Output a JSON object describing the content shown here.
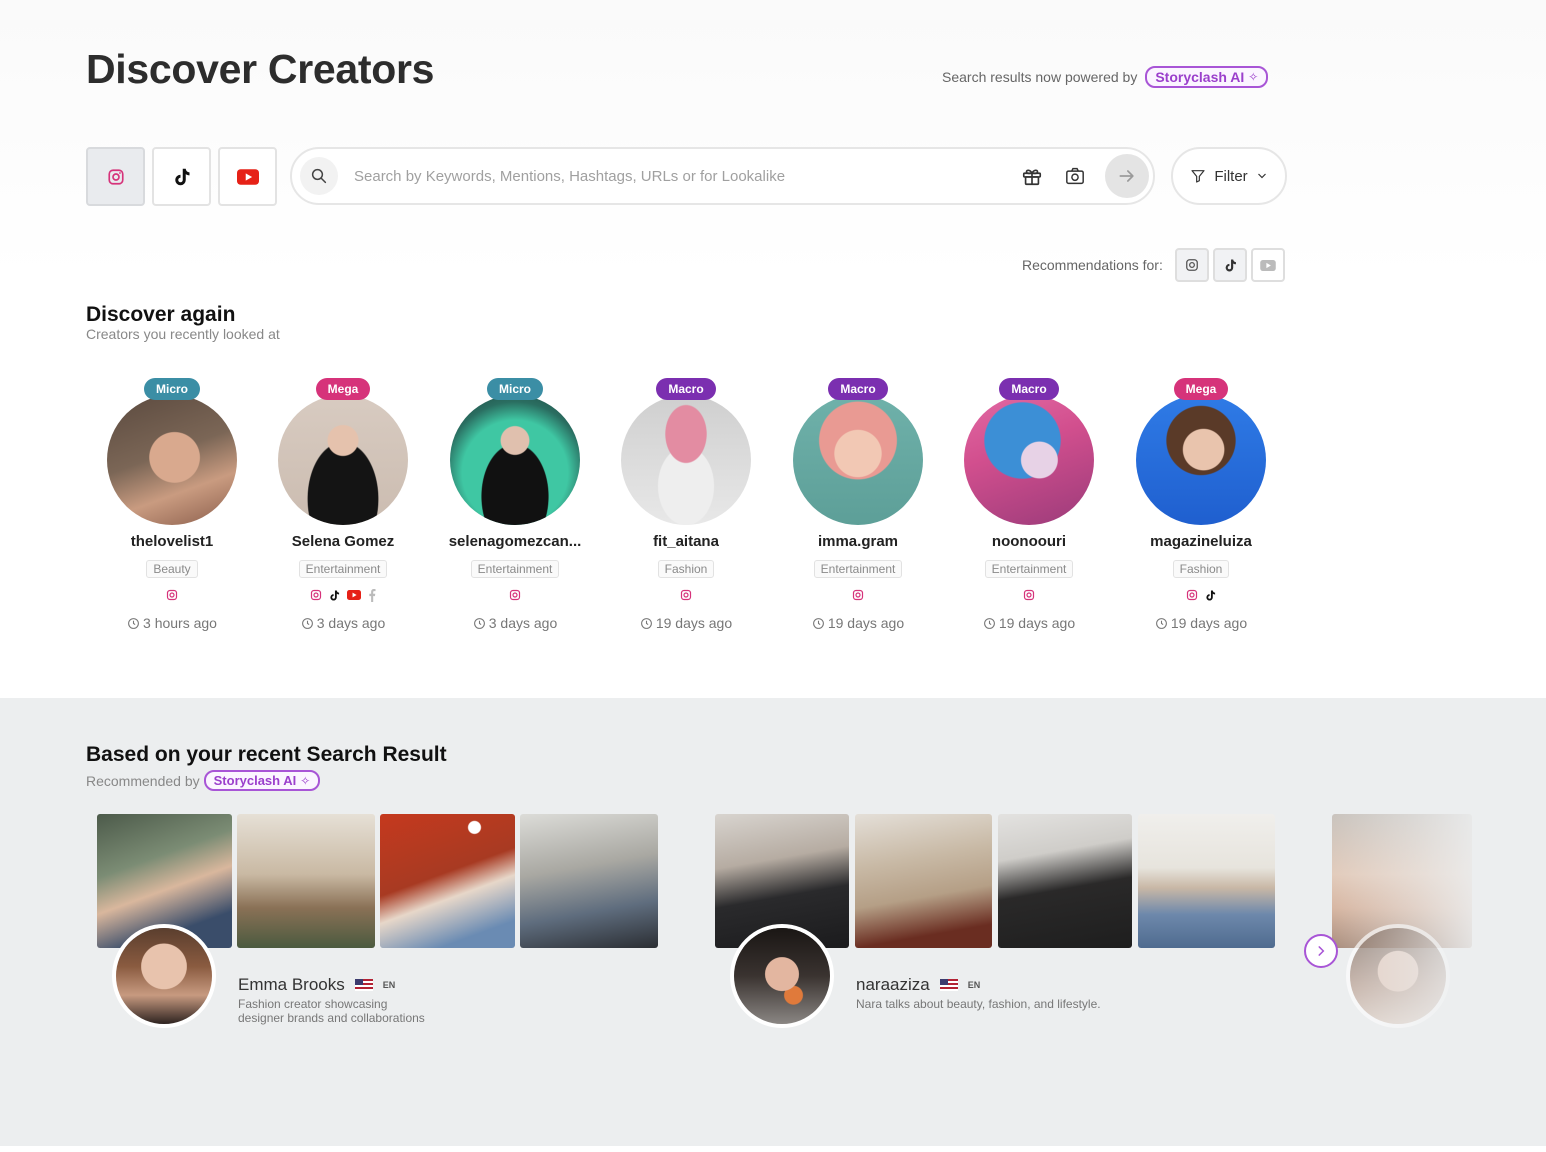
{
  "page": {
    "title": "Discover Creators"
  },
  "powered": {
    "text": "Search results now powered by",
    "badge": "Storyclash AI"
  },
  "platforms": [
    "instagram-icon",
    "tiktok-icon",
    "youtube-icon"
  ],
  "search": {
    "placeholder": "Search by Keywords, Mentions, Hashtags, URLs or for Lookalike",
    "value": ""
  },
  "filter": {
    "label": "Filter"
  },
  "recommendations": {
    "label": "Recommendations for:"
  },
  "discover_again": {
    "title": "Discover again",
    "subtitle": "Creators you recently looked at",
    "creators": [
      {
        "tier": "Micro",
        "name": "thelovelist1",
        "category": "Beauty",
        "platforms": [
          "instagram"
        ],
        "time": "3 hours ago"
      },
      {
        "tier": "Mega",
        "name": "Selena Gomez",
        "category": "Entertainment",
        "platforms": [
          "instagram",
          "tiktok",
          "youtube",
          "facebook"
        ],
        "time": "3 days ago"
      },
      {
        "tier": "Micro",
        "name": "selenagomezcan...",
        "category": "Entertainment",
        "platforms": [
          "instagram"
        ],
        "time": "3 days ago"
      },
      {
        "tier": "Macro",
        "name": "fit_aitana",
        "category": "Fashion",
        "platforms": [
          "instagram"
        ],
        "time": "19 days ago"
      },
      {
        "tier": "Macro",
        "name": "imma.gram",
        "category": "Entertainment",
        "platforms": [
          "instagram"
        ],
        "time": "19 days ago"
      },
      {
        "tier": "Macro",
        "name": "noonoouri",
        "category": "Entertainment",
        "platforms": [
          "instagram"
        ],
        "time": "19 days ago"
      },
      {
        "tier": "Mega",
        "name": "magazineluiza",
        "category": "Fashion",
        "platforms": [
          "instagram",
          "tiktok"
        ],
        "time": "19 days ago"
      }
    ]
  },
  "tier_colors": {
    "Micro": "#3b8ea5",
    "Mega": "#d6337a",
    "Macro": "#7b2fb0"
  },
  "recent": {
    "title": "Based on your recent Search Result",
    "subtitle": "Recommended by",
    "badge": "Storyclash AI",
    "cards": [
      {
        "name": "Emma Brooks",
        "lang": "EN",
        "desc_line1": "Fashion creator showcasing",
        "desc_line2": "designer brands and collaborations"
      },
      {
        "name": "naraaziza",
        "lang": "EN",
        "desc_line1": "Nara talks about beauty, fashion, and lifestyle.",
        "desc_line2": ""
      }
    ]
  },
  "accent": "#a855d6"
}
